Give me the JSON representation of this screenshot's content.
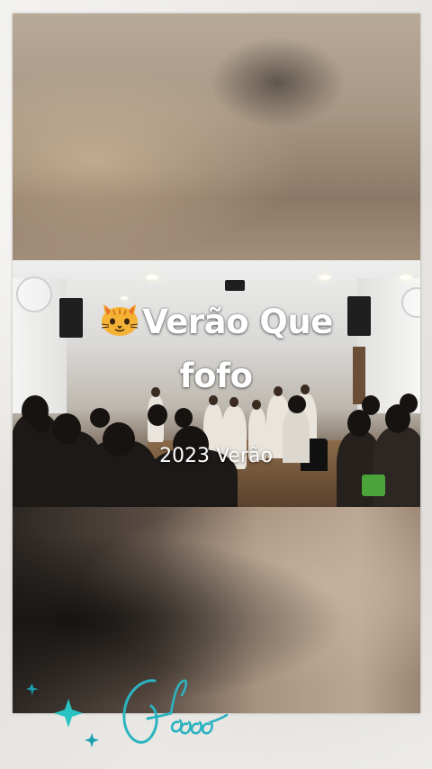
{
  "overlay": {
    "title_line1": "Verão Que",
    "title_line2": "fofo",
    "subtitle": "2023 Verão",
    "title_icon": "cat-face-emoji"
  },
  "decoration": {
    "icons": [
      "sparkle-icon",
      "script-lettering"
    ],
    "accent_color": "#2bb3c0"
  },
  "colors": {
    "background": "#eceae6",
    "text": "#ffffff"
  }
}
